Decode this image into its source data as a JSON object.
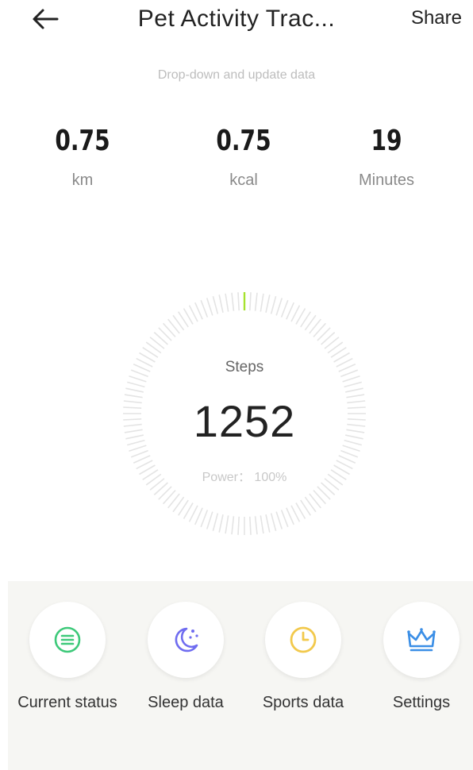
{
  "header": {
    "title": "Pet Activity Trac...",
    "share_label": "Share"
  },
  "hint": "Drop-down and update data",
  "stats": [
    {
      "value": "0.75",
      "unit": "km"
    },
    {
      "value": "0.75",
      "unit": "kcal"
    },
    {
      "value": "19",
      "unit": "Minutes"
    }
  ],
  "steps": {
    "label": "Steps",
    "value": "1252",
    "power": "Power： 100%"
  },
  "nav": [
    {
      "label": "Current status",
      "icon": "list-icon",
      "color": "#3ec97a"
    },
    {
      "label": "Sleep data",
      "icon": "moon-icon",
      "color": "#6f6cf0"
    },
    {
      "label": "Sports data",
      "icon": "clock-icon",
      "color": "#f2c94c"
    },
    {
      "label": "Settings",
      "icon": "crown-icon",
      "color": "#3a8ee6"
    }
  ],
  "colors": {
    "ring_tick": "#e4e4e4",
    "ring_progress": "#a6e22e",
    "panel_bg": "#f6f6f3"
  }
}
